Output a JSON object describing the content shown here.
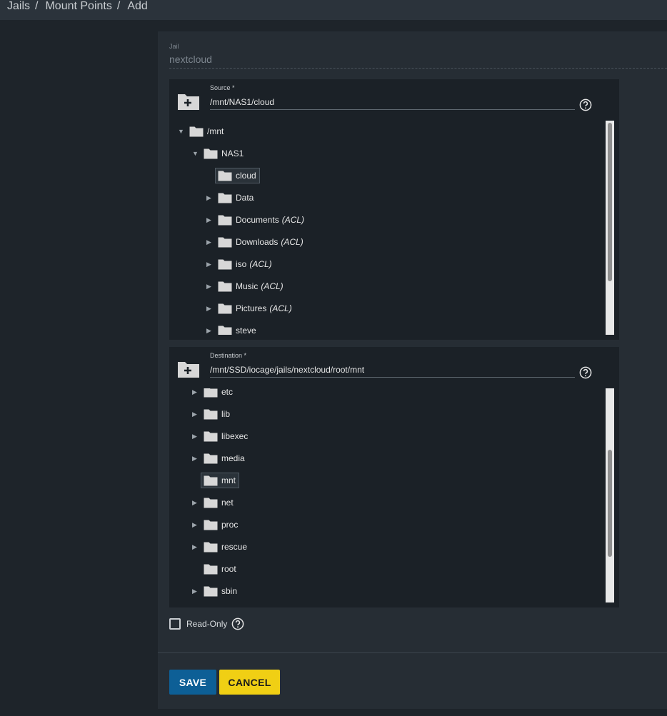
{
  "breadcrumb": [
    "Jails",
    "Mount Points",
    "Add"
  ],
  "jail": {
    "label": "Jail",
    "value": "nextcloud"
  },
  "source": {
    "label": "Source *",
    "value": "/mnt/NAS1/cloud",
    "tree": [
      {
        "name": "/mnt",
        "acl": "",
        "arrow": "down",
        "depth": 0,
        "selected": false
      },
      {
        "name": "NAS1",
        "acl": "",
        "arrow": "down",
        "depth": 1,
        "selected": false
      },
      {
        "name": "cloud",
        "acl": "",
        "arrow": "none",
        "depth": 2,
        "selected": true
      },
      {
        "name": "Data",
        "acl": "",
        "arrow": "right",
        "depth": 2,
        "selected": false
      },
      {
        "name": "Documents",
        "acl": "(ACL)",
        "arrow": "right",
        "depth": 2,
        "selected": false
      },
      {
        "name": "Downloads",
        "acl": "(ACL)",
        "arrow": "right",
        "depth": 2,
        "selected": false
      },
      {
        "name": "iso",
        "acl": "(ACL)",
        "arrow": "right",
        "depth": 2,
        "selected": false
      },
      {
        "name": "Music",
        "acl": "(ACL)",
        "arrow": "right",
        "depth": 2,
        "selected": false
      },
      {
        "name": "Pictures",
        "acl": "(ACL)",
        "arrow": "right",
        "depth": 2,
        "selected": false
      },
      {
        "name": "steve",
        "acl": "",
        "arrow": "right",
        "depth": 2,
        "selected": false
      }
    ]
  },
  "destination": {
    "label": "Destination *",
    "value": "/mnt/SSD/iocage/jails/nextcloud/root/mnt",
    "tree": [
      {
        "name": "etc",
        "acl": "",
        "arrow": "right",
        "depth": 1,
        "selected": false
      },
      {
        "name": "lib",
        "acl": "",
        "arrow": "right",
        "depth": 1,
        "selected": false
      },
      {
        "name": "libexec",
        "acl": "",
        "arrow": "right",
        "depth": 1,
        "selected": false
      },
      {
        "name": "media",
        "acl": "",
        "arrow": "right",
        "depth": 1,
        "selected": false
      },
      {
        "name": "mnt",
        "acl": "",
        "arrow": "none",
        "depth": 1,
        "selected": true
      },
      {
        "name": "net",
        "acl": "",
        "arrow": "right",
        "depth": 1,
        "selected": false
      },
      {
        "name": "proc",
        "acl": "",
        "arrow": "right",
        "depth": 1,
        "selected": false
      },
      {
        "name": "rescue",
        "acl": "",
        "arrow": "right",
        "depth": 1,
        "selected": false
      },
      {
        "name": "root",
        "acl": "",
        "arrow": "none",
        "depth": 1,
        "selected": false
      },
      {
        "name": "sbin",
        "acl": "",
        "arrow": "right",
        "depth": 1,
        "selected": false
      }
    ]
  },
  "readonly": {
    "label": "Read-Only",
    "checked": false
  },
  "buttons": {
    "save": "SAVE",
    "cancel": "CANCEL"
  },
  "colors": {
    "background": "#1e242a",
    "card": "#262d34",
    "explorer": "#1b2127",
    "save": "#0d5f96",
    "cancel": "#f0cf14"
  }
}
